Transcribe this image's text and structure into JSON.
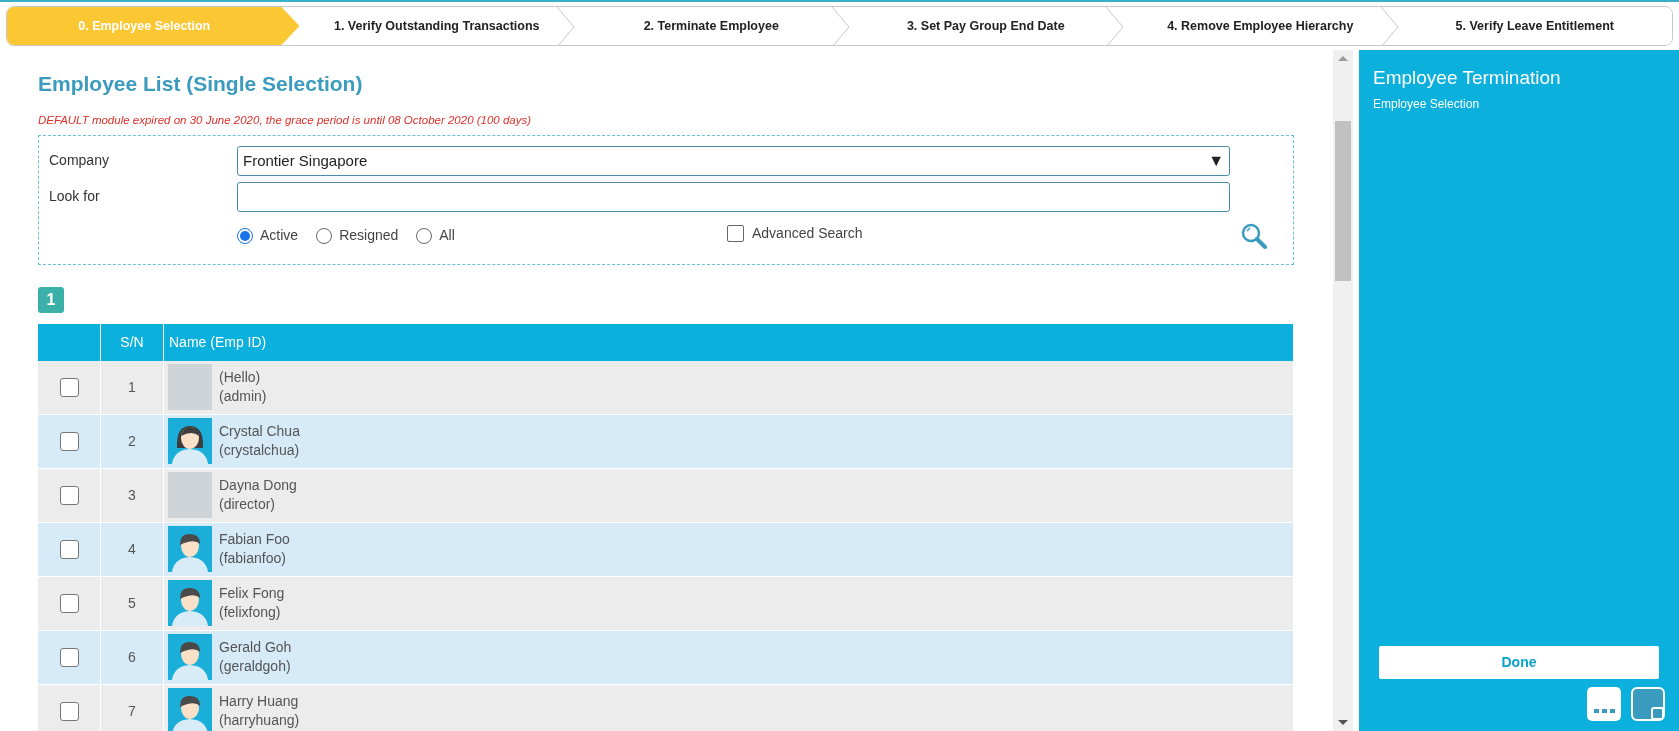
{
  "steps": [
    {
      "label": "0. Employee Selection",
      "selected": true
    },
    {
      "label": "1. Verify Outstanding Transactions",
      "selected": false
    },
    {
      "label": "2. Terminate Employee",
      "selected": false
    },
    {
      "label": "3. Set Pay Group End Date",
      "selected": false
    },
    {
      "label": "4. Remove Employee Hierarchy",
      "selected": false
    },
    {
      "label": "5. Verify Leave Entitlement",
      "selected": false
    }
  ],
  "page_title": "Employee List (Single Selection)",
  "warning": "DEFAULT module expired on 30 June 2020, the grace period is until 08 October 2020 (100 days)",
  "filter": {
    "company_label": "Company",
    "company_value": "Frontier Singapore",
    "dropdown_arrow": "▼",
    "look_for_label": "Look for",
    "status_options": [
      {
        "label": "Active",
        "selected": true
      },
      {
        "label": "Resigned",
        "selected": false
      },
      {
        "label": "All",
        "selected": false
      }
    ],
    "advanced_search": {
      "label": "Advanced Search",
      "checked": false
    }
  },
  "pages": [
    {
      "label": "1",
      "selected": true
    }
  ],
  "table": {
    "columns": [
      "S/N",
      "Name (Emp ID)"
    ],
    "rows": [
      {
        "checked": false,
        "sn": "1",
        "avatar": {
          "kind": "photo"
        },
        "name": "(Hello)",
        "emp_id": "(admin)"
      },
      {
        "checked": false,
        "sn": "2",
        "avatar": {
          "kind": "female"
        },
        "name": "Crystal Chua",
        "emp_id": "(crystalchua)"
      },
      {
        "checked": false,
        "sn": "3",
        "avatar": {
          "kind": "photo"
        },
        "name": "Dayna Dong",
        "emp_id": "(director)"
      },
      {
        "checked": false,
        "sn": "4",
        "avatar": {
          "kind": "male"
        },
        "name": "Fabian Foo",
        "emp_id": "(fabianfoo)"
      },
      {
        "checked": false,
        "sn": "5",
        "avatar": {
          "kind": "male"
        },
        "name": "Felix Fong",
        "emp_id": "(felixfong)"
      },
      {
        "checked": false,
        "sn": "6",
        "avatar": {
          "kind": "male"
        },
        "name": "Gerald Goh",
        "emp_id": "(geraldgoh)"
      },
      {
        "checked": false,
        "sn": "7",
        "avatar": {
          "kind": "male"
        },
        "name": "Harry Huang",
        "emp_id": "(harryhuang)"
      }
    ]
  },
  "side_panel": {
    "title": "Employee Termination",
    "subtitle": "Employee Selection",
    "done_button": "Done"
  }
}
